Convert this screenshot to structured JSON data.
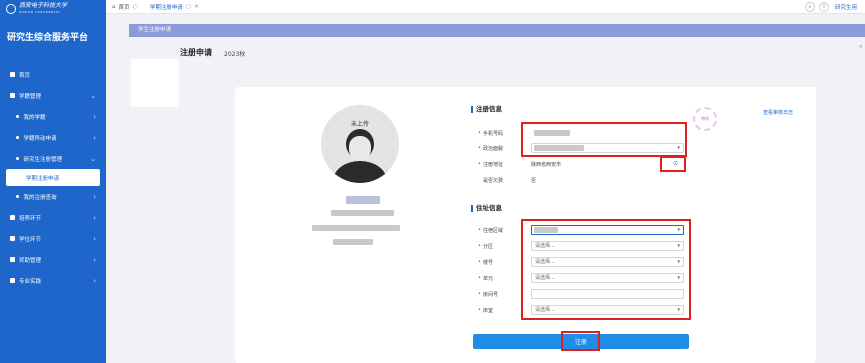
{
  "university": {
    "name_cn": "西安电子科技大学",
    "name_en": "XIDIAN UNIVERSITY"
  },
  "system_title": "研究生综合服务平台",
  "sidebar": {
    "items": [
      {
        "label": "首页",
        "kind": "top"
      },
      {
        "label": "学籍管理",
        "kind": "group",
        "arrow": "⌄"
      },
      {
        "label": "我的学籍",
        "kind": "sub",
        "arrow": "›"
      },
      {
        "label": "学籍异动申请",
        "kind": "sub",
        "arrow": "›"
      },
      {
        "label": "研究生注册管理",
        "kind": "sub",
        "arrow": "⌄"
      },
      {
        "label": "学期注册申请",
        "kind": "active"
      },
      {
        "label": "我的注册查询",
        "kind": "sub",
        "arrow": "›"
      },
      {
        "label": "培养环节",
        "kind": "group",
        "arrow": "›"
      },
      {
        "label": "学位环节",
        "kind": "group",
        "arrow": "›"
      },
      {
        "label": "奖助管理",
        "kind": "group",
        "arrow": "›"
      },
      {
        "label": "专业实践",
        "kind": "group",
        "arrow": "›"
      }
    ]
  },
  "topbar": {
    "tabs": [
      {
        "label": "首页",
        "icon": "home-icon"
      },
      {
        "label": "学期注册申请",
        "icon": "refresh-icon"
      }
    ],
    "right_link": "研究生用"
  },
  "subbar_label": "学生注册申请",
  "page": {
    "title": "注册申请",
    "term": "2023秋"
  },
  "avatar_label": "未上传",
  "register_info": {
    "section_title": "注册信息",
    "view_log": "查看审核日志",
    "stamp": "审核",
    "rows": [
      {
        "label": "手机号码",
        "required": true,
        "value": ""
      },
      {
        "label": "政治面貌",
        "required": true,
        "value": ""
      },
      {
        "label": "注册地址",
        "required": true,
        "value": "陕西省西安市"
      },
      {
        "label": "是否欠费",
        "required": false,
        "value": "否"
      }
    ]
  },
  "address_info": {
    "section_title": "住址信息",
    "rows": [
      {
        "label": "住宿区域",
        "required": true,
        "value": ""
      },
      {
        "label": "分区",
        "required": true,
        "value": "请选择..."
      },
      {
        "label": "楼号",
        "required": true,
        "value": "请选择..."
      },
      {
        "label": "单元",
        "required": true,
        "value": "请选择..."
      },
      {
        "label": "房间号",
        "required": true,
        "value": ""
      },
      {
        "label": "床室",
        "required": true,
        "value": "请选择..."
      }
    ]
  },
  "submit_label": "注册"
}
